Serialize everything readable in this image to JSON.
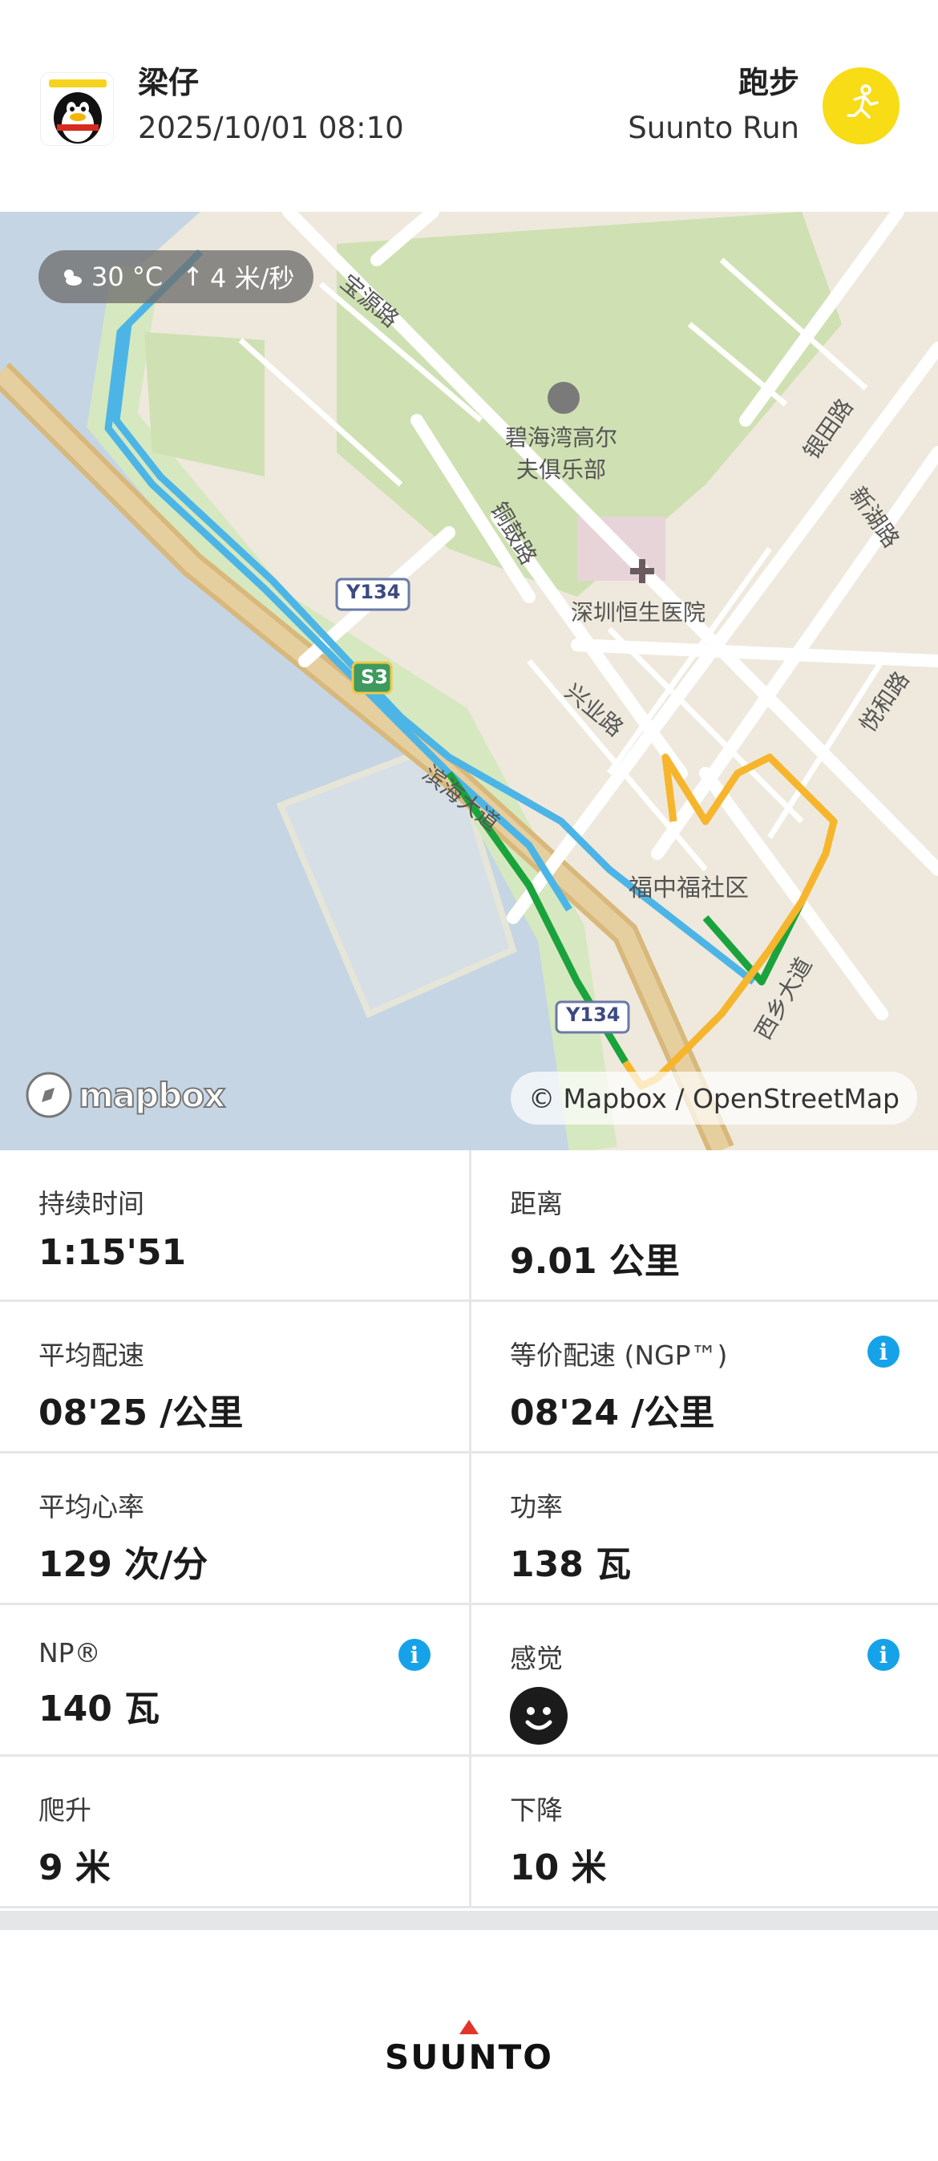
{
  "header": {
    "user_name": "梁仔",
    "datetime": "2025/10/01 08:10",
    "activity_type": "跑步",
    "activity_app": "Suunto Run",
    "activity_icon": "running-person-icon",
    "accent_color": "#f7dc16"
  },
  "map": {
    "weather": {
      "temperature": "30 °C",
      "wind": "4 米/秒"
    },
    "attribution": "© Mapbox / OpenStreetMap",
    "logo_text": "mapbox",
    "labels": {
      "golf_club_line1": "碧海湾高尔",
      "golf_club_line2": "夫俱乐部",
      "hospital": "深圳恒生医院",
      "xingye_road": "兴业路",
      "community": "福中福社区",
      "baoyuan_road": "宝源路",
      "tonggu_road": "铜鼓路",
      "yintian_road": "银田路",
      "xinhu_road": "新湖路",
      "yuehe_road": "悦和路",
      "xixiang_road": "西乡大道",
      "bayside_road": "滨海大道",
      "road_y134_a": "Y134",
      "road_y134_b": "Y134",
      "road_s3": "S3"
    },
    "route_colors": {
      "blue": "#4db5e6",
      "green": "#1aa33c",
      "orange": "#f6b52c"
    }
  },
  "stats": [
    {
      "label": "持续时间",
      "value": "1:15'51",
      "info": false
    },
    {
      "label": "距离",
      "value": "9.01 公里",
      "info": false
    },
    {
      "label": "平均配速",
      "value": "08'25 /公里",
      "info": false
    },
    {
      "label": "等价配速 (NGP™)",
      "value": "08'24 /公里",
      "info": true
    },
    {
      "label": "平均心率",
      "value": "129 次/分",
      "info": false
    },
    {
      "label": "功率",
      "value": "138 瓦",
      "info": false
    },
    {
      "label": "NP®",
      "value": "140 瓦",
      "info": true
    },
    {
      "label": "感觉",
      "value": "",
      "info": true
    },
    {
      "label": "爬升",
      "value": "9 米",
      "info": false
    },
    {
      "label": "下降",
      "value": "10 米",
      "info": false
    }
  ],
  "footer": {
    "brand": "SUUNTO"
  }
}
